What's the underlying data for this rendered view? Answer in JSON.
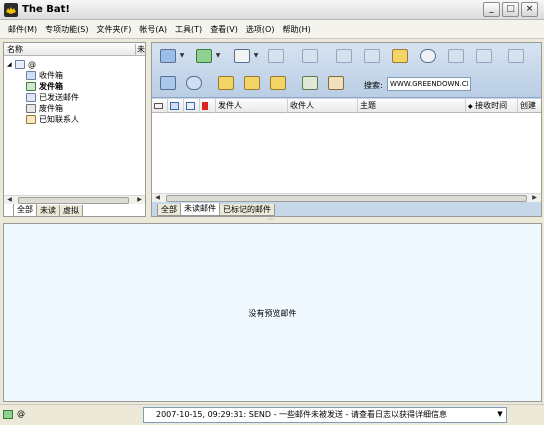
{
  "window": {
    "title": "The Bat!",
    "minimize": "_",
    "maximize": "□",
    "close": "×"
  },
  "menu": [
    "邮件(M)",
    "专项功能(S)",
    "文件夹(F)",
    "帐号(A)",
    "工具(T)",
    "查看(V)",
    "选项(O)",
    "帮助(H)"
  ],
  "folder_pane": {
    "col_name": "名称",
    "col_unread": "未",
    "account": "@",
    "folders": [
      "收件箱",
      "发件箱",
      "已发送邮件",
      "废件箱",
      "已知联系人"
    ],
    "tabs": [
      "全部",
      "未读",
      "虚拟"
    ]
  },
  "search": {
    "label": "搜索:",
    "value": "WWW.GREENDOWN.CN"
  },
  "message_list": {
    "columns": [
      "发件人",
      "收件人",
      "主题",
      "接收时间",
      "创建"
    ],
    "tabs": [
      "全部",
      "未读邮件",
      "已标记的邮件"
    ]
  },
  "preview": {
    "empty_text": "没有预览邮件"
  },
  "status": {
    "left": "@",
    "log": "2007-10-15, 09:29:31: SEND  - 一些邮件未被发送 - 请查看日志以获得详细信息",
    "dropdown": "▼"
  },
  "colors": {
    "accent_blue": "#b9cde4",
    "preview_bg": "#f0f9ff",
    "folder_yellow": "#f3d466",
    "flag_red": "#d22"
  },
  "icons": {
    "toolbar": [
      "get-mail-icon",
      "send-mail-icon",
      "new-message-icon",
      "reply-icon",
      "reply-all-icon",
      "forward-icon",
      "address-book-icon",
      "find-icon",
      "print-icon",
      "delete-icon",
      "folder-new-icon",
      "folder-properties-icon",
      "folder-move-icon",
      "filter-icon",
      "sorting-icon"
    ]
  }
}
